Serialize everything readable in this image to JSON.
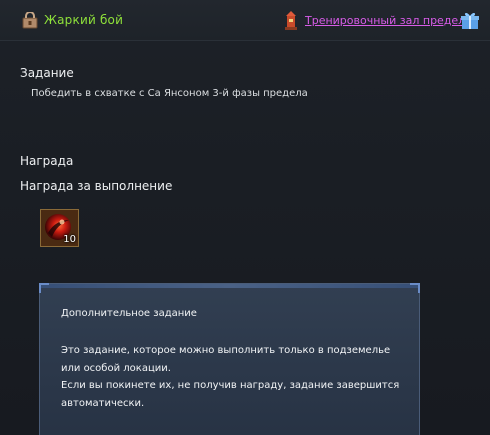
{
  "header": {
    "quest_title": "Жаркий бой",
    "quest_icon": "lock-quest-icon",
    "location_icon": "tower-location-icon",
    "location_link": "Тренировочный зал предела",
    "gift_icon": "gift-icon"
  },
  "task": {
    "label": "Задание",
    "text": "Победить в схватке с Са Янсоном 3-й фазы предела"
  },
  "reward": {
    "label": "Награда",
    "completion_label": "Награда за выполнение",
    "item_icon": "red-orb-icon",
    "item_count": "10"
  },
  "tooltip": {
    "title": "Дополнительное задание",
    "line1": "Это задание, которое можно выполнить только в подземелье",
    "line2": "или особой локации.",
    "line3": "Если вы покинете их, не получив награду, задание завершится",
    "line4": "автоматически."
  },
  "colors": {
    "quest_title": "#8ee03a",
    "location_link": "#d85ce8",
    "background": "#181c22",
    "tooltip_bg": "#34425a"
  }
}
